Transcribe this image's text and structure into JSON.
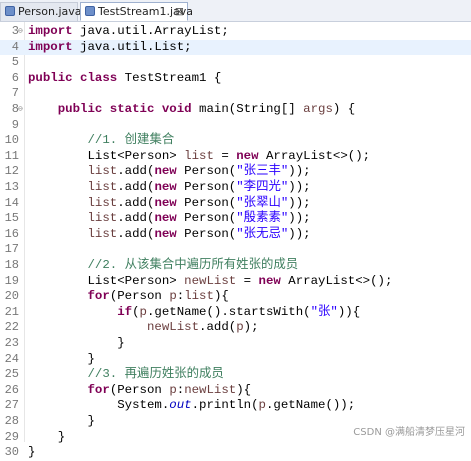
{
  "tabs": [
    {
      "label": "Person.java",
      "active": false
    },
    {
      "label": "TestStream1.java",
      "active": true,
      "close": "⊠"
    }
  ],
  "editor": {
    "lines": [
      {
        "num": "3",
        "fold": "⊖",
        "tokens": [
          {
            "t": "import",
            "c": "kw"
          },
          {
            "t": " java.util.ArrayList;",
            "c": "tok"
          }
        ]
      },
      {
        "num": "4",
        "hl": true,
        "tokens": [
          {
            "t": "import",
            "c": "kw"
          },
          {
            "t": " java.util.List;",
            "c": "tok"
          }
        ]
      },
      {
        "num": "5",
        "tokens": []
      },
      {
        "num": "6",
        "tokens": [
          {
            "t": "public class",
            "c": "kw"
          },
          {
            "t": " TestStream1 {",
            "c": "tok"
          }
        ]
      },
      {
        "num": "7",
        "tokens": []
      },
      {
        "num": "8",
        "fold": "⊖",
        "tokens": [
          {
            "t": "    public static void",
            "c": "kw"
          },
          {
            "t": " main(String[] ",
            "c": "tok"
          },
          {
            "t": "args",
            "c": "var"
          },
          {
            "t": ") {",
            "c": "tok"
          }
        ]
      },
      {
        "num": "9",
        "tokens": []
      },
      {
        "num": "10",
        "tokens": [
          {
            "t": "        //1. 创建集合",
            "c": "cmt"
          }
        ]
      },
      {
        "num": "11",
        "tokens": [
          {
            "t": "        List<Person> ",
            "c": "tok"
          },
          {
            "t": "list",
            "c": "var"
          },
          {
            "t": " = ",
            "c": "tok"
          },
          {
            "t": "new",
            "c": "kw"
          },
          {
            "t": " ArrayList<>();",
            "c": "tok"
          }
        ]
      },
      {
        "num": "12",
        "tokens": [
          {
            "t": "        ",
            "c": "tok"
          },
          {
            "t": "list",
            "c": "var"
          },
          {
            "t": ".add(",
            "c": "tok"
          },
          {
            "t": "new",
            "c": "kw"
          },
          {
            "t": " Person(",
            "c": "tok"
          },
          {
            "t": "\"张三丰\"",
            "c": "str"
          },
          {
            "t": "));",
            "c": "tok"
          }
        ]
      },
      {
        "num": "13",
        "tokens": [
          {
            "t": "        ",
            "c": "tok"
          },
          {
            "t": "list",
            "c": "var"
          },
          {
            "t": ".add(",
            "c": "tok"
          },
          {
            "t": "new",
            "c": "kw"
          },
          {
            "t": " Person(",
            "c": "tok"
          },
          {
            "t": "\"李四光\"",
            "c": "str"
          },
          {
            "t": "));",
            "c": "tok"
          }
        ]
      },
      {
        "num": "14",
        "tokens": [
          {
            "t": "        ",
            "c": "tok"
          },
          {
            "t": "list",
            "c": "var"
          },
          {
            "t": ".add(",
            "c": "tok"
          },
          {
            "t": "new",
            "c": "kw"
          },
          {
            "t": " Person(",
            "c": "tok"
          },
          {
            "t": "\"张翠山\"",
            "c": "str"
          },
          {
            "t": "));",
            "c": "tok"
          }
        ]
      },
      {
        "num": "15",
        "tokens": [
          {
            "t": "        ",
            "c": "tok"
          },
          {
            "t": "list",
            "c": "var"
          },
          {
            "t": ".add(",
            "c": "tok"
          },
          {
            "t": "new",
            "c": "kw"
          },
          {
            "t": " Person(",
            "c": "tok"
          },
          {
            "t": "\"殷素素\"",
            "c": "str"
          },
          {
            "t": "));",
            "c": "tok"
          }
        ]
      },
      {
        "num": "16",
        "tokens": [
          {
            "t": "        ",
            "c": "tok"
          },
          {
            "t": "list",
            "c": "var"
          },
          {
            "t": ".add(",
            "c": "tok"
          },
          {
            "t": "new",
            "c": "kw"
          },
          {
            "t": " Person(",
            "c": "tok"
          },
          {
            "t": "\"张无忌\"",
            "c": "str"
          },
          {
            "t": "));",
            "c": "tok"
          }
        ]
      },
      {
        "num": "17",
        "tokens": []
      },
      {
        "num": "18",
        "tokens": [
          {
            "t": "        //2. 从该集合中遍历所有姓张的成员",
            "c": "cmt"
          }
        ]
      },
      {
        "num": "19",
        "tokens": [
          {
            "t": "        List<Person> ",
            "c": "tok"
          },
          {
            "t": "newList",
            "c": "var"
          },
          {
            "t": " = ",
            "c": "tok"
          },
          {
            "t": "new",
            "c": "kw"
          },
          {
            "t": " ArrayList<>();",
            "c": "tok"
          }
        ]
      },
      {
        "num": "20",
        "tokens": [
          {
            "t": "        ",
            "c": "tok"
          },
          {
            "t": "for",
            "c": "kw"
          },
          {
            "t": "(Person ",
            "c": "tok"
          },
          {
            "t": "p",
            "c": "var"
          },
          {
            "t": ":",
            "c": "tok"
          },
          {
            "t": "list",
            "c": "var"
          },
          {
            "t": "){",
            "c": "tok"
          }
        ]
      },
      {
        "num": "21",
        "tokens": [
          {
            "t": "            ",
            "c": "tok"
          },
          {
            "t": "if",
            "c": "kw"
          },
          {
            "t": "(",
            "c": "tok"
          },
          {
            "t": "p",
            "c": "var"
          },
          {
            "t": ".getName().startsWith(",
            "c": "tok"
          },
          {
            "t": "\"张\"",
            "c": "str"
          },
          {
            "t": ")){",
            "c": "tok"
          }
        ]
      },
      {
        "num": "22",
        "tokens": [
          {
            "t": "                ",
            "c": "tok"
          },
          {
            "t": "newList",
            "c": "var"
          },
          {
            "t": ".add(",
            "c": "tok"
          },
          {
            "t": "p",
            "c": "var"
          },
          {
            "t": ");",
            "c": "tok"
          }
        ]
      },
      {
        "num": "23",
        "tokens": [
          {
            "t": "            }",
            "c": "tok"
          }
        ]
      },
      {
        "num": "24",
        "tokens": [
          {
            "t": "        }",
            "c": "tok"
          }
        ]
      },
      {
        "num": "25",
        "tokens": [
          {
            "t": "        //3. 再遍历姓张的成员",
            "c": "cmt"
          }
        ]
      },
      {
        "num": "26",
        "tokens": [
          {
            "t": "        ",
            "c": "tok"
          },
          {
            "t": "for",
            "c": "kw"
          },
          {
            "t": "(Person ",
            "c": "tok"
          },
          {
            "t": "p",
            "c": "var"
          },
          {
            "t": ":",
            "c": "tok"
          },
          {
            "t": "newList",
            "c": "var"
          },
          {
            "t": "){",
            "c": "tok"
          }
        ]
      },
      {
        "num": "27",
        "tokens": [
          {
            "t": "            System.",
            "c": "tok"
          },
          {
            "t": "out",
            "c": "fld"
          },
          {
            "t": ".println(",
            "c": "tok"
          },
          {
            "t": "p",
            "c": "var"
          },
          {
            "t": ".getName());",
            "c": "tok"
          }
        ]
      },
      {
        "num": "28",
        "tokens": [
          {
            "t": "        }",
            "c": "tok"
          }
        ]
      },
      {
        "num": "29",
        "tokens": [
          {
            "t": "    }",
            "c": "tok"
          }
        ]
      },
      {
        "num": "30",
        "tokens": [
          {
            "t": "}",
            "c": "tok"
          }
        ]
      }
    ]
  },
  "watermark": "CSDN @满船清梦压星河",
  "colors": {
    "keyword": "#7f0055",
    "string": "#2a00ff",
    "comment": "#3f7f5f",
    "static_field": "#0000c0",
    "local_variable": "#6a3e3e",
    "current_line": "#e8f2fe"
  }
}
